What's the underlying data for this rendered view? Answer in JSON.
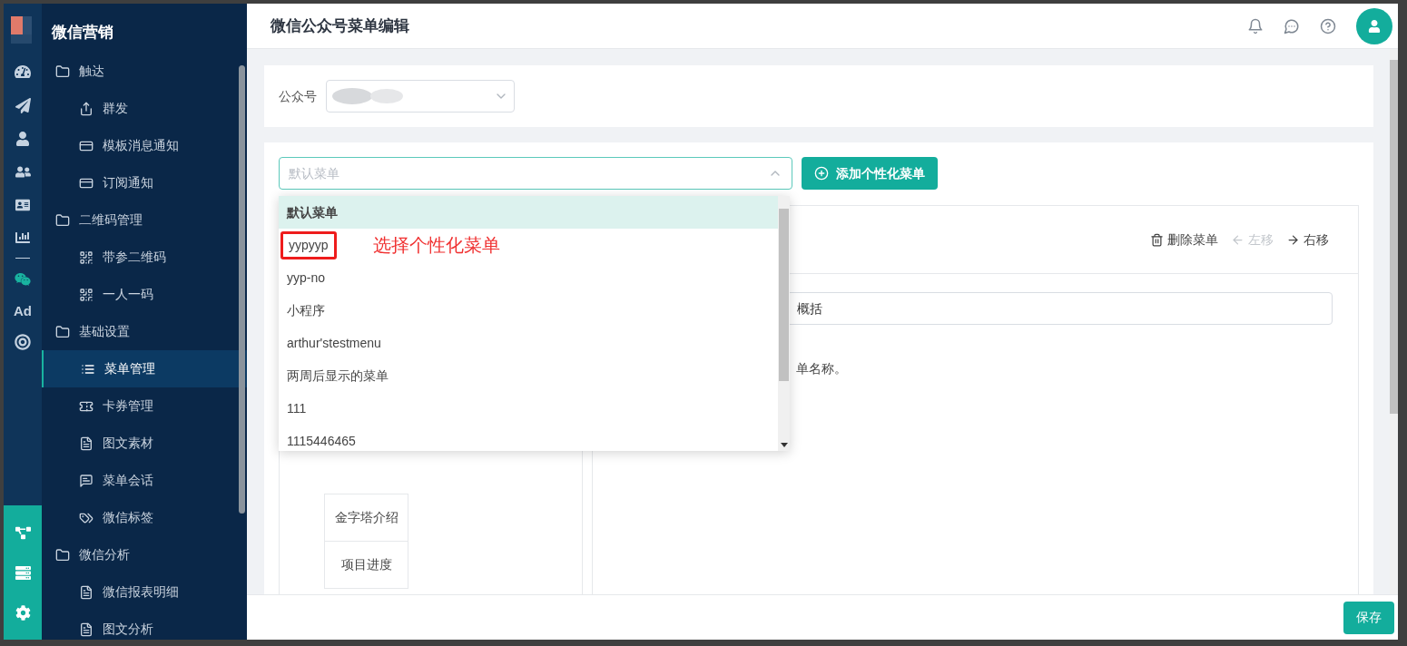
{
  "sidebar": {
    "title": "微信营销",
    "groups": [
      {
        "label": "触达",
        "children": [
          {
            "label": "群发",
            "selected": false
          },
          {
            "label": "模板消息通知",
            "selected": false
          },
          {
            "label": "订阅通知",
            "selected": false
          }
        ]
      },
      {
        "label": "二维码管理",
        "children": [
          {
            "label": "带参二维码",
            "selected": false
          },
          {
            "label": "一人一码",
            "selected": false
          }
        ]
      },
      {
        "label": "基础设置",
        "children": [
          {
            "label": "菜单管理",
            "selected": true
          },
          {
            "label": "卡券管理",
            "selected": false
          },
          {
            "label": "图文素材",
            "selected": false
          },
          {
            "label": "菜单会话",
            "selected": false
          },
          {
            "label": "微信标签",
            "selected": false
          }
        ]
      },
      {
        "label": "微信分析",
        "children": [
          {
            "label": "微信报表明细",
            "selected": false
          },
          {
            "label": "图文分析",
            "selected": false
          }
        ]
      }
    ]
  },
  "rail": {
    "ad_label": "Ad"
  },
  "header": {
    "title": "微信公众号菜单编辑"
  },
  "account": {
    "label": "公众号"
  },
  "menu_select": {
    "placeholder": "默认菜单",
    "add_button": "添加个性化菜单",
    "options": [
      {
        "label": "默认菜单",
        "selected": true,
        "annotated": false
      },
      {
        "label": "yypyyp",
        "selected": false,
        "annotated": true
      },
      {
        "label": "yyp-no",
        "selected": false,
        "annotated": false
      },
      {
        "label": "小程序",
        "selected": false,
        "annotated": false
      },
      {
        "label": "arthur'stestmenu",
        "selected": false,
        "annotated": false
      },
      {
        "label": "两周后显示的菜单",
        "selected": false,
        "annotated": false
      },
      {
        "label": "111",
        "selected": false,
        "annotated": false
      },
      {
        "label": "1115446465",
        "selected": false,
        "annotated": false
      }
    ]
  },
  "annotation": "选择个性化菜单",
  "editor": {
    "actions": [
      {
        "label": "删除菜单",
        "kind": "delete",
        "disabled": false
      },
      {
        "label": "左移",
        "kind": "left",
        "disabled": true
      },
      {
        "label": "右移",
        "kind": "right",
        "disabled": false
      }
    ],
    "name_value": "概括",
    "hint": "单名称。"
  },
  "preview_items": [
    "金字塔介绍",
    "项目进度"
  ],
  "footer": {
    "save": "保存"
  }
}
